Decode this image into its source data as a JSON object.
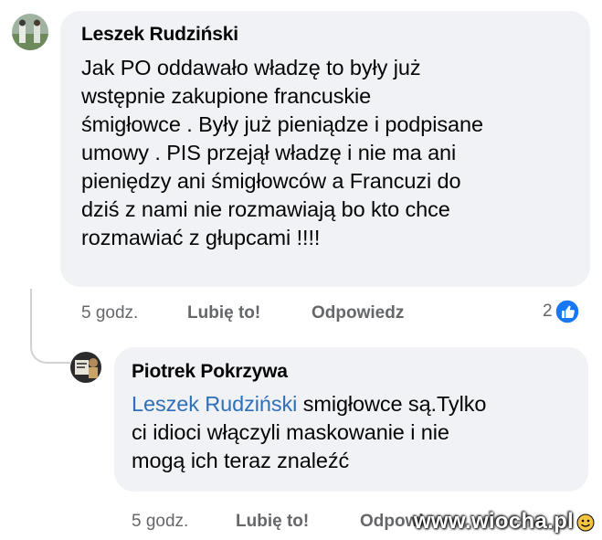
{
  "comment1": {
    "author": "Leszek Rudziński",
    "lines": [
      "Jak PO oddawało władzę to były już",
      "wstępnie zakupione francuskie",
      "śmigłowce . Były już pieniądze i podpisane",
      "umowy . PIS przejął władzę i nie ma ani",
      "pieniędzy ani śmigłowców a Francuzi do",
      "dziś z nami nie rozmawiają bo kto chce",
      "rozmawiać z głupcami !!!!"
    ],
    "time": "5 godz.",
    "like_label": "Lubię to!",
    "reply_label": "Odpowiedz",
    "reaction_count": "2",
    "reaction_icon": "like-icon"
  },
  "reply1": {
    "author": "Piotrek Pokrzywa",
    "mention": "Leszek Rudziński",
    "line1_rest": " smigłowce są.Tylko",
    "line2": "ci idioci włączyli maskowanie i nie",
    "line3": "mogą ich teraz znaleźć",
    "time": "5 godz.",
    "like_label": "Lubię to!",
    "reply_label": "Odpowi"
  },
  "watermark": "www.wiocha.pl",
  "colors": {
    "bubble": "#f0f2f5",
    "mention": "#2e6fb8",
    "like_blue": "#1877f2",
    "meta_grey": "#65676b"
  }
}
